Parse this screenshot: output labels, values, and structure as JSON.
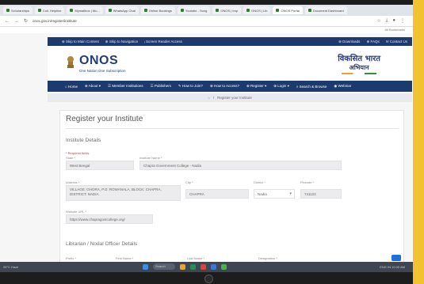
{
  "browser": {
    "tabs": [
      "Scholarships",
      "Coll. Helpline",
      "Mymailbox | Mu...",
      "WhatsApp Chat",
      "Online Bookings",
      "Youtube - Song",
      "ONOS | Imp",
      "ONOS | Lib",
      "ONOS Portal",
      "Document Dashboard"
    ],
    "url": "onos.gov.in/register/institute",
    "all_bookmarks": "All Bookmarks"
  },
  "topstrip": {
    "skip_main": "⊕ Skip to Main Content",
    "skip_nav": "⊕ Skip to Navigation",
    "screen_reader": "ᵢ Screen Reader Access",
    "downloads": "⊕ Downloads",
    "faqs": "⊕ FAQs",
    "contact": "✉ Contact Us"
  },
  "header": {
    "logo": "ONOS",
    "logo_sub": "One Nation One Subscription",
    "vb_line1": "विकसित भारत",
    "vb_line2": "अभियान"
  },
  "mainnav": {
    "items": [
      "⌂ Home",
      "⊕ About ▾",
      "☰ Member Institutions",
      "☰ Publishers",
      "✎ How to Join?",
      "⊕ How to Access?",
      "⊕ Register ▾",
      "⊕ Login ▾",
      "⌕ Search & Browse",
      "◉ Webinar"
    ]
  },
  "breadcrumb": {
    "home_icon": "home-icon",
    "sep": "/",
    "current": "Register your Institute"
  },
  "form": {
    "title": "Register your Institute",
    "institute_section": "Institute Details",
    "required_note": "* Required fields",
    "state_label": "State *",
    "state_value": "West Bengal",
    "institute_name_label": "Institute Name *",
    "institute_name_value": "Chapra Government College - Nadia",
    "address_label": "Address *",
    "address_value": "VILLAGE: GHORA, P.O: ROWANALA, BLOCK: CHAPRA, DISTRICT: NADIA",
    "city_label": "City *",
    "city_value": "CHAPRA",
    "district_label": "District *",
    "district_value": "Nadia",
    "pincode_label": "Pincode *",
    "pincode_value": "741123",
    "website_label": "Website URL *",
    "website_value": "https://www.chapragovtcollege.org/",
    "librarian_section": "Librarian / Nodal Officer Details",
    "prefix_label": "Prefix *",
    "first_name_label": "First Name *",
    "last_name_label": "Last Name *",
    "designation_label": "Designation *"
  },
  "taskbar": {
    "weather": "26°C Haze",
    "search": "Search",
    "clock": "ENG IN  10:30 AM"
  }
}
